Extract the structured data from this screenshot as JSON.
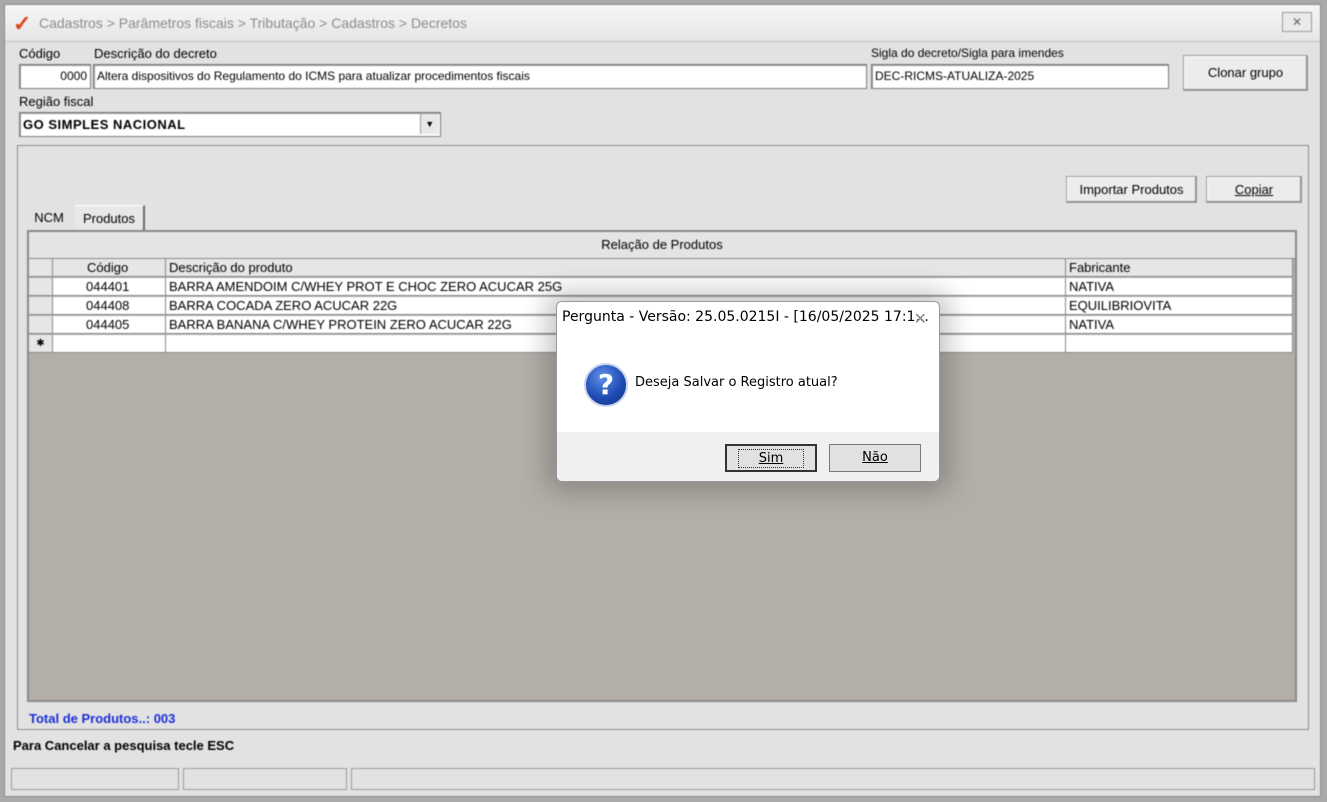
{
  "window": {
    "breadcrumb": "Cadastros > Parâmetros fiscais > Tributação > Cadastros > Decretos",
    "close_icon": "close-icon"
  },
  "form": {
    "codigo_label": "Código",
    "codigo_value": "0000",
    "descricao_label": "Descrição do decreto",
    "descricao_value": "Altera dispositivos do Regulamento do ICMS para atualizar procedimentos fiscais",
    "sigla_label": "Sigla do decreto/Sigla para imendes",
    "sigla_value": "DEC-RICMS-ATUALIZA-2025",
    "clonar_label": "Clonar grupo",
    "regiao_label": "Região fiscal",
    "regiao_value": "GO SIMPLES NACIONAL"
  },
  "toolbar": {
    "importar_label": "Importar Produtos",
    "copiar_label": "Copiar"
  },
  "tabs": [
    {
      "label": "NCM"
    },
    {
      "label": "Produtos"
    }
  ],
  "grid": {
    "caption": "Relação de Produtos",
    "columns": [
      "Código",
      "Descrição do produto",
      "Fabricante"
    ],
    "rows": [
      {
        "codigo": "044401",
        "descricao": "BARRA AMENDOIM C/WHEY PROT E CHOC ZERO ACUCAR 25G",
        "fabricante": "NATIVA"
      },
      {
        "codigo": "044408",
        "descricao": "BARRA COCADA ZERO ACUCAR 22G",
        "fabricante": "EQUILIBRIOVITA"
      },
      {
        "codigo": "044405",
        "descricao": "BARRA BANANA C/WHEY PROTEIN ZERO ACUCAR 22G",
        "fabricante": "NATIVA"
      }
    ],
    "new_row_marker": "✱"
  },
  "footer": {
    "total": "Total de Produtos..: 003",
    "hint": "Para Cancelar a pesquisa tecle ESC"
  },
  "dialog": {
    "title": "Pergunta - Versão: 25.05.0215I - [16/05/2025 17:1...",
    "message": "Deseja Salvar o Registro atual?",
    "yes_label": "Sim",
    "no_label": "Não",
    "icon": "question-icon"
  },
  "colors": {
    "total_text": "#1b2fd6",
    "logo": "#e2451c"
  }
}
